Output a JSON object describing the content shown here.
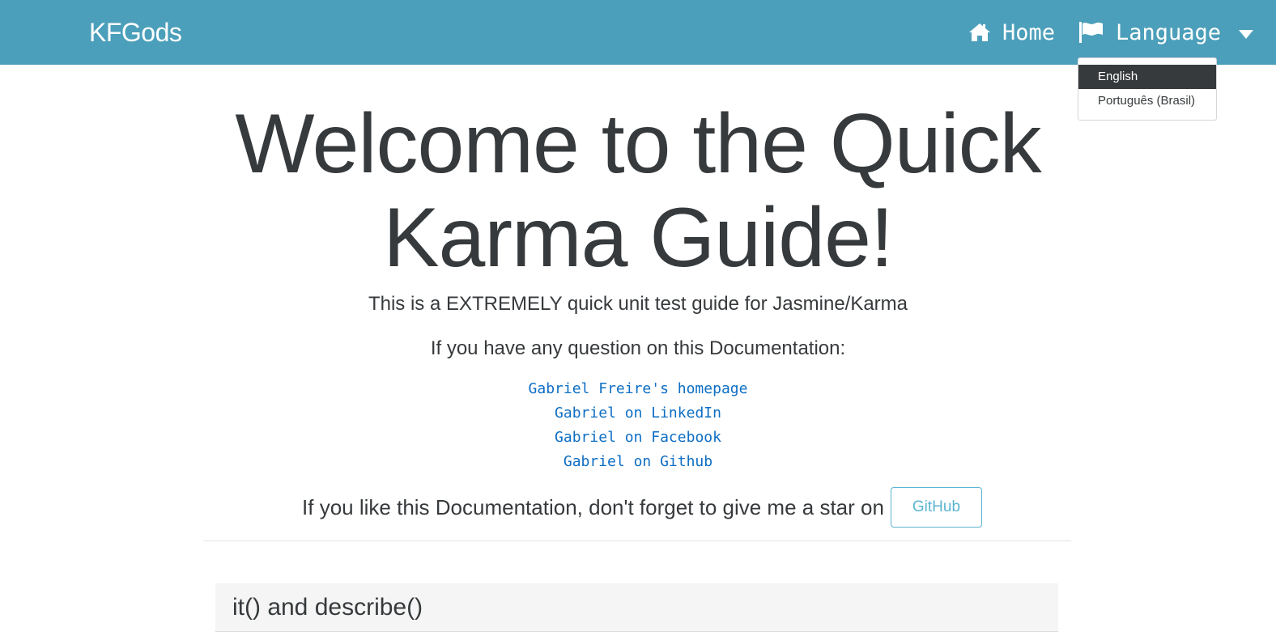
{
  "navbar": {
    "brand": "KFGods",
    "home_label": "Home",
    "home_icon": "home-icon",
    "language_label": "Language",
    "language_icon": "flag-icon",
    "background": "#4c9fba"
  },
  "language_menu": {
    "items": [
      {
        "label": "English",
        "active": true
      },
      {
        "label": "Português (Brasil)",
        "active": false
      }
    ]
  },
  "hero": {
    "title_line1": "Welcome to the Quick",
    "title_line2": "Karma Guide!",
    "subtitle": "This is a EXTREMELY quick unit test guide for Jasmine/Karma",
    "question_text": "If you have any question on this Documentation:"
  },
  "contact_links": [
    "Gabriel Freire's homepage",
    "Gabriel on LinkedIn",
    "Gabriel on Facebook",
    "Gabriel on Github"
  ],
  "star": {
    "text": "If you like this Documentation, don't forget to give me a star on",
    "button_label": "GitHub"
  },
  "section": {
    "title": "it() and describe()"
  },
  "colors": {
    "link": "#0d6ec4",
    "button_outline": "#5bb4d1",
    "active_item_bg": "#373a3c"
  }
}
